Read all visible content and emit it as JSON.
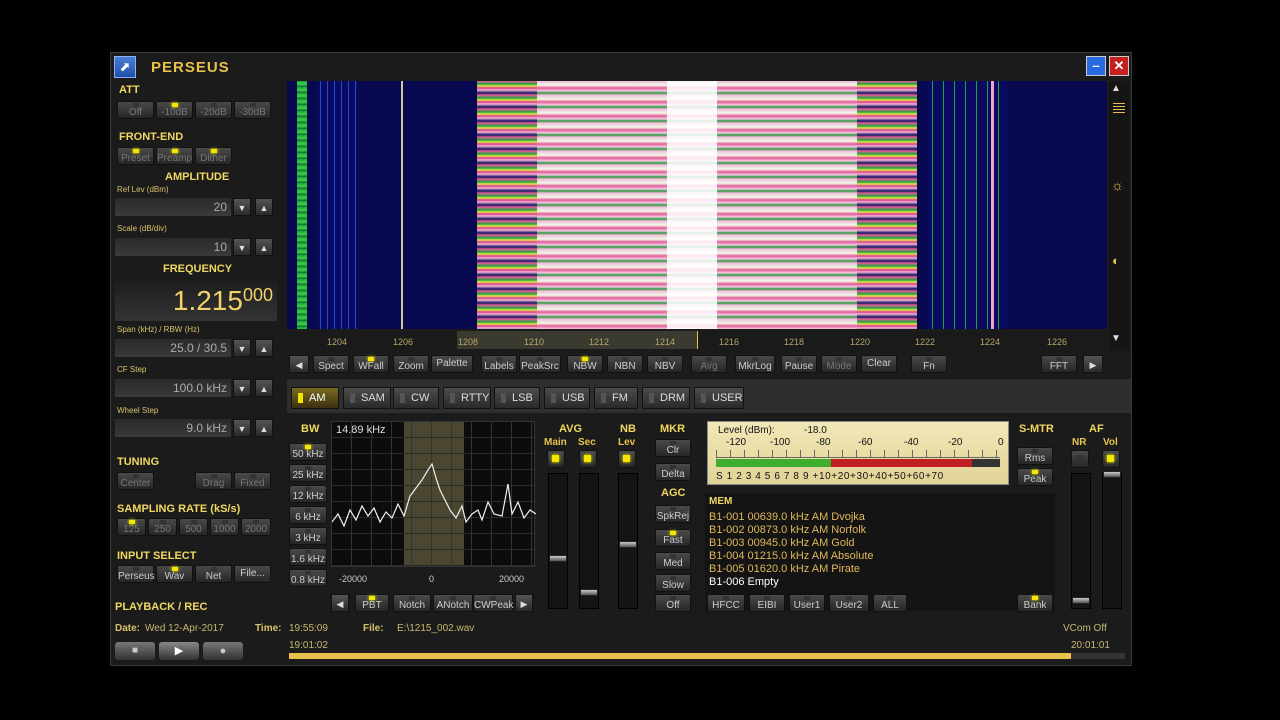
{
  "app": {
    "title": "PERSEUS",
    "logo_glyph": "⬈",
    "minimize": "–",
    "close": "✕"
  },
  "att": {
    "label": "ATT",
    "buttons": [
      "Off",
      "-10dB",
      "-20dB",
      "-30dB"
    ]
  },
  "front_end": {
    "label": "FRONT-END",
    "buttons": [
      "Preset",
      "Preamp",
      "Dither"
    ]
  },
  "amplitude": {
    "label": "AMPLITUDE",
    "ref_label": "Ref Lev (dBm)",
    "ref_value": "20",
    "scale_label": "Scale (dB/div)",
    "scale_value": "10"
  },
  "frequency": {
    "label": "FREQUENCY",
    "main": "1.215",
    "sub": "000"
  },
  "span": {
    "label": "Span (kHz) / RBW (Hz)",
    "value": "25.0 / 30.5"
  },
  "cf_step": {
    "label": "CF Step",
    "value": "100.0 kHz"
  },
  "wheel_step": {
    "label": "Wheel Step",
    "value": "9.0 kHz"
  },
  "tuning": {
    "label": "TUNING",
    "buttons": [
      "Center",
      "Drag",
      "Fixed"
    ]
  },
  "sampling": {
    "label": "SAMPLING RATE (kS/s)",
    "buttons": [
      "125",
      "250",
      "500",
      "1000",
      "2000"
    ]
  },
  "input": {
    "label": "INPUT SELECT",
    "buttons": [
      "Perseus",
      "Wav",
      "Net",
      "File..."
    ]
  },
  "playback": {
    "label": "PLAYBACK / REC",
    "date_label": "Date:",
    "date": "Wed 12-Apr-2017",
    "time_label": "Time:",
    "time": "19:55:09",
    "file_label": "File:",
    "file": "E:\\1215_002.wav",
    "vcom": "VCom Off",
    "start": "19:01:02",
    "end": "20:01:01",
    "progress": 0.935
  },
  "freq_axis": [
    "1204",
    "1206",
    "1208",
    "1210",
    "1212",
    "1214",
    "1216",
    "1218",
    "1220",
    "1222",
    "1224",
    "1226"
  ],
  "spectrum_buttons": [
    "Spect",
    "WFall",
    "Zoom",
    "Palette",
    "Labels",
    "PeakSrc",
    "NBW",
    "NBN",
    "NBV",
    "Avg",
    "MkrLog",
    "Pause",
    "Mode",
    "Clear",
    "Fn",
    "FFT"
  ],
  "modes": [
    "AM",
    "SAM",
    "CW",
    "RTTY",
    "LSB",
    "USB",
    "FM",
    "DRM",
    "USER"
  ],
  "bw": {
    "label": "BW",
    "value": "14.89 kHz",
    "buttons": [
      "50 kHz",
      "25 kHz",
      "12 kHz",
      "6 kHz",
      "3 kHz",
      "1.6 kHz",
      "0.8 kHz"
    ],
    "axis": [
      "-20000",
      "0",
      "20000"
    ],
    "bottom_buttons": [
      "PBT",
      "Notch",
      "ANotch",
      "CWPeak"
    ]
  },
  "avg": {
    "label": "AVG",
    "main": "Main",
    "sec": "Sec"
  },
  "nb": {
    "label": "NB",
    "lev": "Lev"
  },
  "mkr": {
    "label": "MKR",
    "buttons": [
      "Clr",
      "Delta"
    ]
  },
  "agc": {
    "label": "AGC",
    "buttons": [
      "SpkRej",
      "Fast",
      "Med",
      "Slow",
      "Off"
    ]
  },
  "level": {
    "label": "Level (dBm):",
    "value": "-18.0",
    "scale_top": [
      "-120",
      "-100",
      "-80",
      "-60",
      "-40",
      "-20",
      "0"
    ],
    "scale_bottom": "S 1 2 3 4 5 6 7 8 9 +10+20+30+40+50+60+70",
    "fill": 0.9
  },
  "smtr": {
    "label": "S-MTR",
    "buttons": [
      "Rms",
      "Peak"
    ]
  },
  "af": {
    "label": "AF",
    "nr": "NR",
    "vol": "Vol"
  },
  "mem": {
    "label": "MEM",
    "items": [
      "B1-001 00639.0 kHz  AM  Dvojka",
      "B1-002 00873.0 kHz  AM  Norfolk",
      "B1-003 00945.0 kHz  AM  Gold",
      "B1-004 01215.0 kHz  AM  Absolute",
      "B1-005 01620.0 kHz  AM  Pirate",
      "B1-006 Empty"
    ],
    "buttons": [
      "HFCC",
      "EIBI",
      "User1",
      "User2",
      "ALL",
      "Bank"
    ]
  }
}
